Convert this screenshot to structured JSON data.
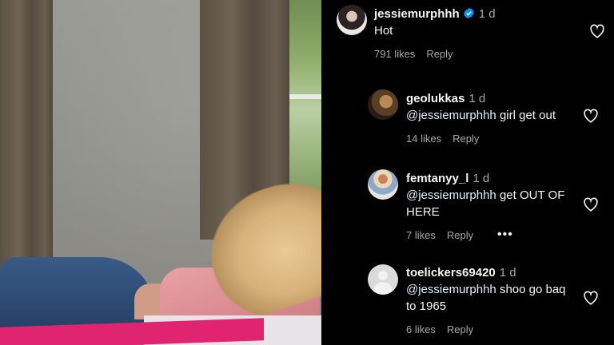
{
  "media": {
    "description_icon": "photo"
  },
  "comments": [
    {
      "username": "jessiemurphhh",
      "verified": true,
      "time": "1 d",
      "mention": "",
      "text": "Hot",
      "likes": "791 likes",
      "reply": "Reply"
    },
    {
      "username": "geolukkas",
      "verified": false,
      "time": "1 d",
      "mention": "@jessiemurphhh",
      "text": " girl get out",
      "likes": "14 likes",
      "reply": "Reply"
    },
    {
      "username": "femtanyy_l",
      "verified": false,
      "time": "1 d",
      "mention": "@jessiemurphhh",
      "text": " get OUT OF HERE",
      "likes": "7 likes",
      "reply": "Reply",
      "more": "•••"
    },
    {
      "username": "toelickers69420",
      "verified": false,
      "time": "1 d",
      "mention": "@jessiemurphhh",
      "text": " shoo go baq to 1965",
      "likes": "6 likes",
      "reply": "Reply"
    }
  ],
  "colors": {
    "background": "#000000",
    "text": "#f5f5f5",
    "secondary": "#a8a8a8",
    "mention": "#e0f1ff",
    "verified": "#0095f6"
  },
  "icons": {
    "like": "heart-outline-icon",
    "verified": "verified-badge-icon",
    "more": "more-options-icon"
  }
}
